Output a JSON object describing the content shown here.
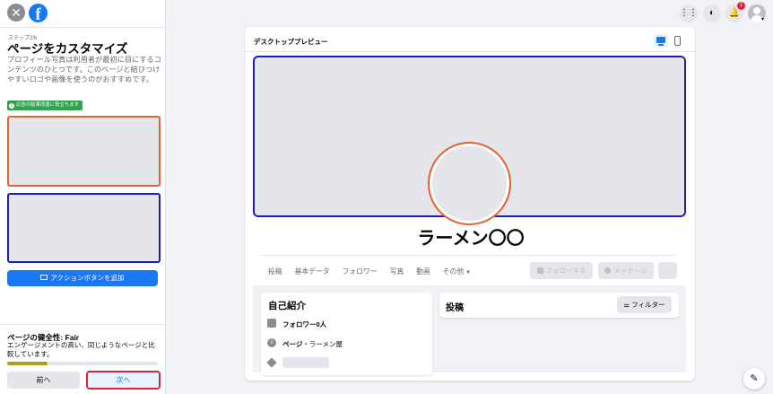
{
  "left_panel": {
    "step_label": "ステップ2/6",
    "title": "ページをカスタマイズ",
    "description": "プロフィール写真は利用者が最初に目にするコンテンツのひとつです。このページと結びつけやすいロゴや画像を使うのがおすすめです。",
    "ad_tag": "広告の結果改善に役立ちます",
    "action_button": "アクションボタンを追加"
  },
  "health": {
    "title": "ページの健全性: Fair",
    "description": "エンゲージメントの高い、同じようなページと比較しています。",
    "progress": 0.27
  },
  "footer": {
    "prev": "前へ",
    "next": "次へ"
  },
  "top_icons": {
    "notification_count": "1"
  },
  "preview": {
    "title": "デスクトッププレビュー",
    "page_name": "ラーメン〇〇",
    "tabs": [
      "投稿",
      "基本データ",
      "フォロワー",
      "写真",
      "動画",
      "その他"
    ],
    "follow_button": "フォローする",
    "message_button": "メッセージ",
    "more_button": "···",
    "intro": {
      "title": "自己紹介",
      "followers": "フォロワー0人",
      "page_category_prefix": "ページ",
      "page_category_sep": "・",
      "page_category": "ラーメン屋"
    },
    "posts": {
      "title": "投稿",
      "filter": "フィルター"
    }
  },
  "colors": {
    "facebook_blue": "#1877f2",
    "highlight_orange": "#e4622f",
    "highlight_navy": "#1d1dbd",
    "next_button_border": "#e41e3f",
    "tag_green": "#31a24c",
    "health_bar": "#b39c1a"
  }
}
